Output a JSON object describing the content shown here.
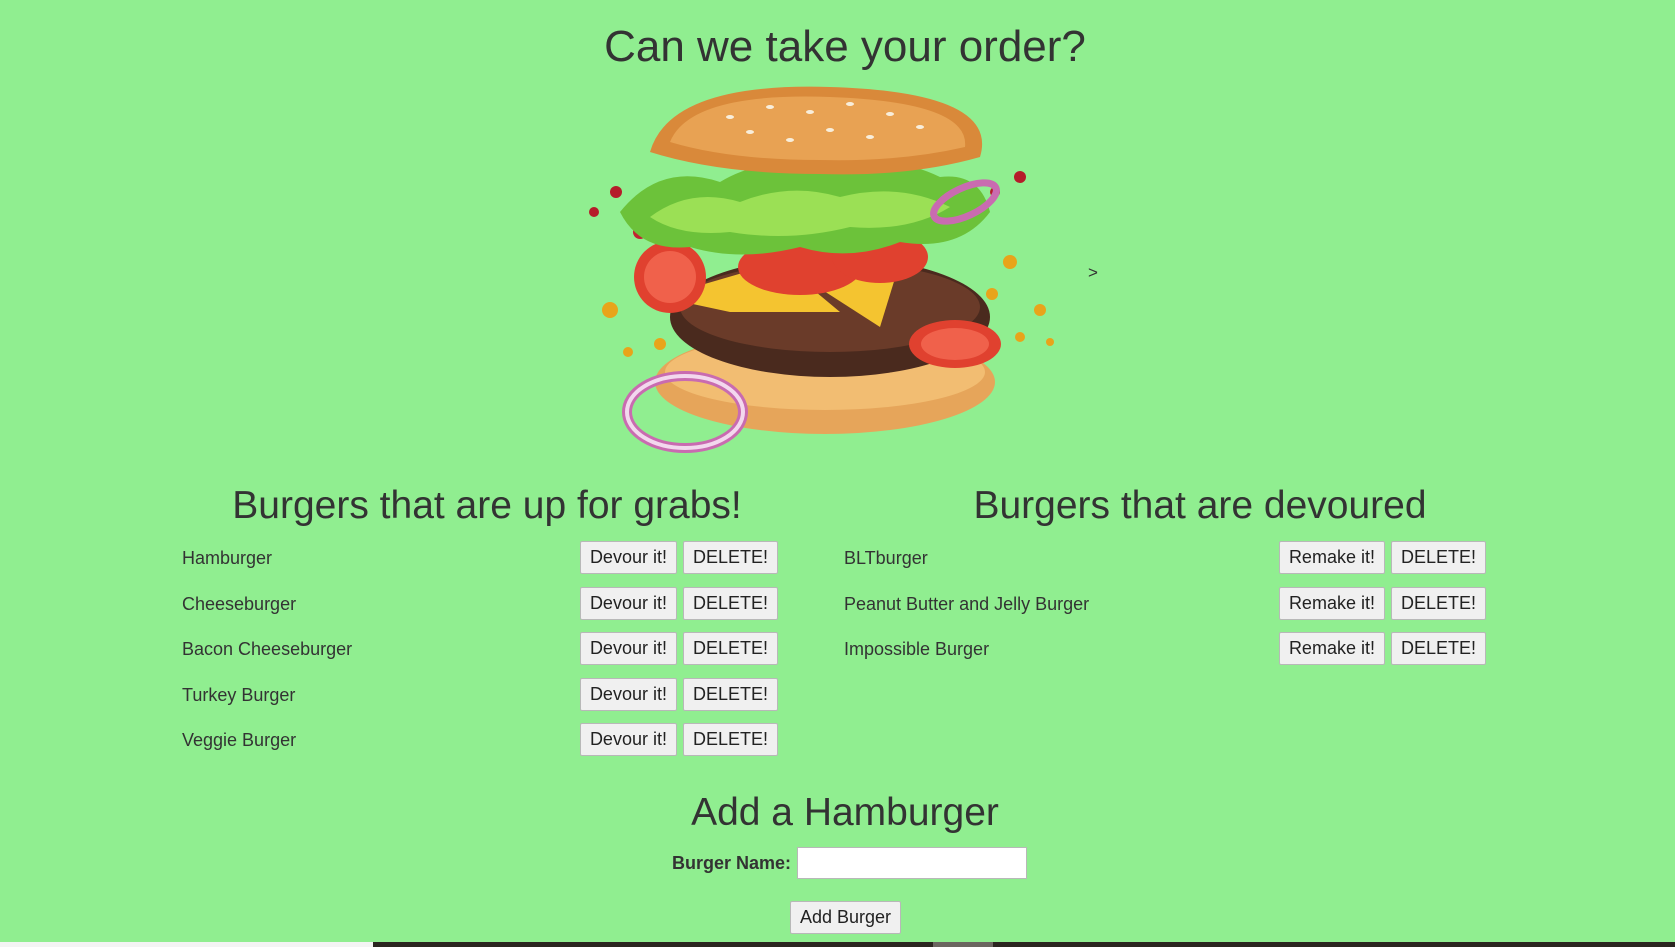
{
  "header": {
    "title": "Can we take your order?"
  },
  "hero": {
    "image": "exploding-burger-illustration",
    "stray_text": ">"
  },
  "available": {
    "title": "Burgers that are up for grabs!",
    "primary_label": "Devour it!",
    "delete_label": "DELETE!",
    "items": [
      {
        "name": "Hamburger"
      },
      {
        "name": "Cheeseburger"
      },
      {
        "name": "Bacon Cheeseburger"
      },
      {
        "name": "Turkey Burger"
      },
      {
        "name": "Veggie Burger"
      }
    ]
  },
  "devoured": {
    "title": "Burgers that are devoured",
    "primary_label": "Remake it!",
    "delete_label": "DELETE!",
    "items": [
      {
        "name": "BLTburger"
      },
      {
        "name": "Peanut Butter and Jelly Burger"
      },
      {
        "name": "Impossible Burger"
      }
    ]
  },
  "form": {
    "title": "Add a Hamburger",
    "label": "Burger Name:",
    "input_value": "",
    "input_placeholder": "",
    "submit_label": "Add Burger"
  },
  "colors": {
    "page_background": "#90ee90",
    "text": "#333333",
    "button_background": "#f0f0f0"
  }
}
